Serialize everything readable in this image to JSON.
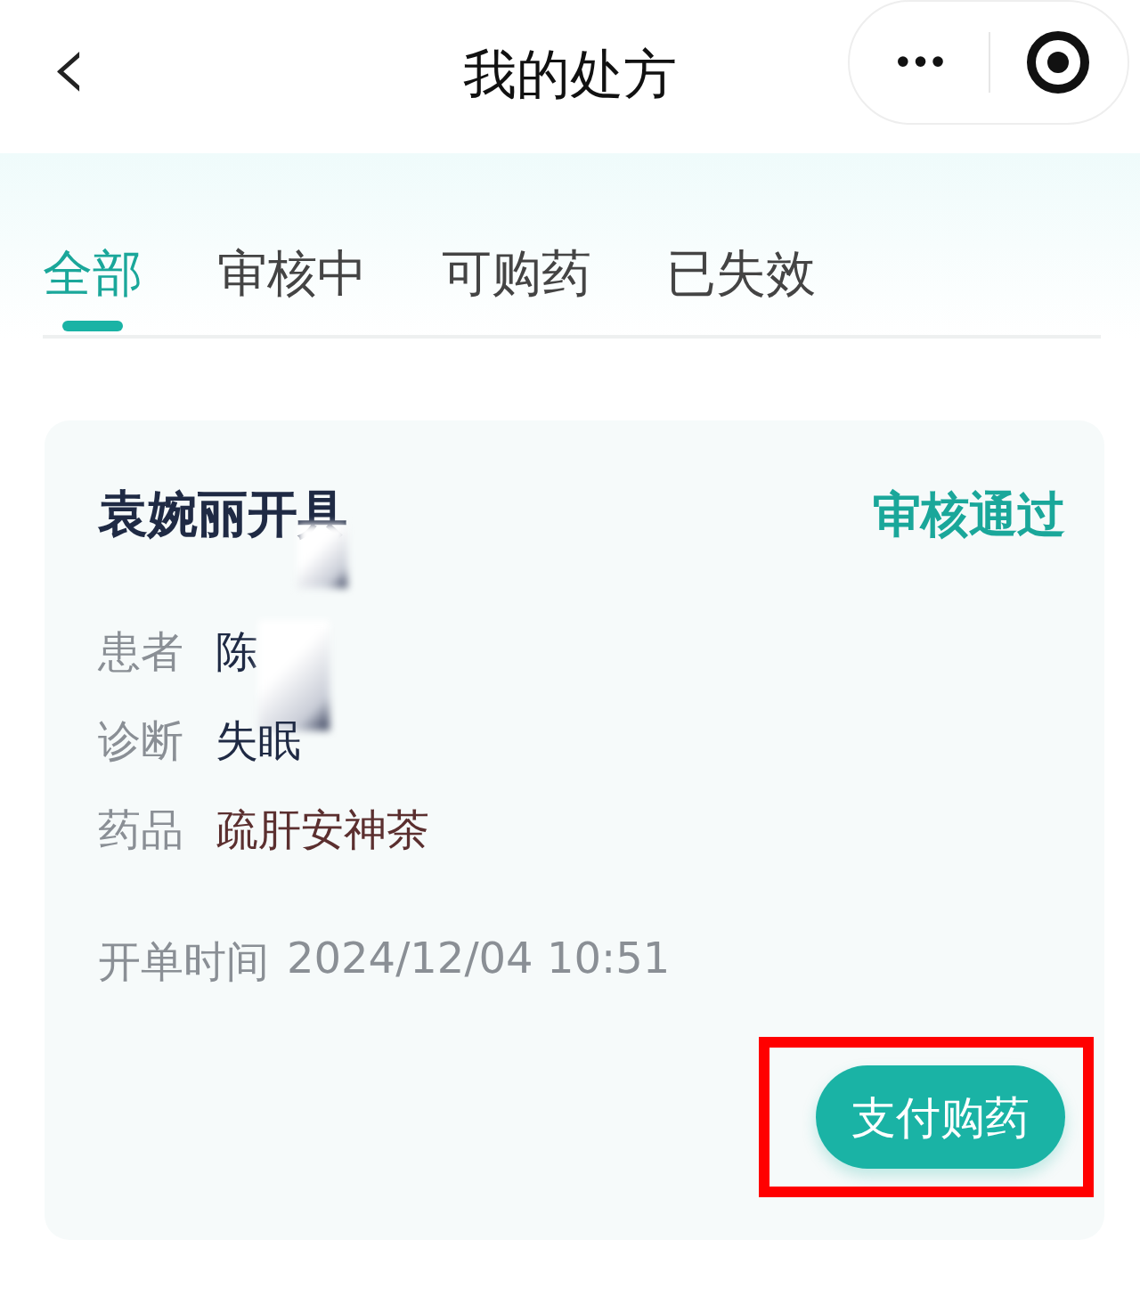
{
  "header": {
    "back": "‹",
    "title": "我的处方",
    "more": "•••"
  },
  "tabs": [
    {
      "label": "全部",
      "selected": true
    },
    {
      "label": "审核中",
      "selected": false
    },
    {
      "label": "可购药",
      "selected": false
    },
    {
      "label": "已失效",
      "selected": false
    }
  ],
  "prescription": {
    "doctor": "袁婉丽开具",
    "doctor_redacted": true,
    "status": "审核通过",
    "fields": [
      {
        "label": "患者",
        "value": "陈",
        "kind": "person",
        "redacted": true
      },
      {
        "label": "诊断",
        "value": "失眠",
        "kind": "plain",
        "redacted": false
      },
      {
        "label": "药品",
        "value": "疏肝安神茶",
        "kind": "drug",
        "redacted": false
      }
    ],
    "issued_label": "开单时间",
    "issued_time": "2024/12/04 10:51",
    "action": {
      "label": "支付购药",
      "highlighted": true
    }
  }
}
